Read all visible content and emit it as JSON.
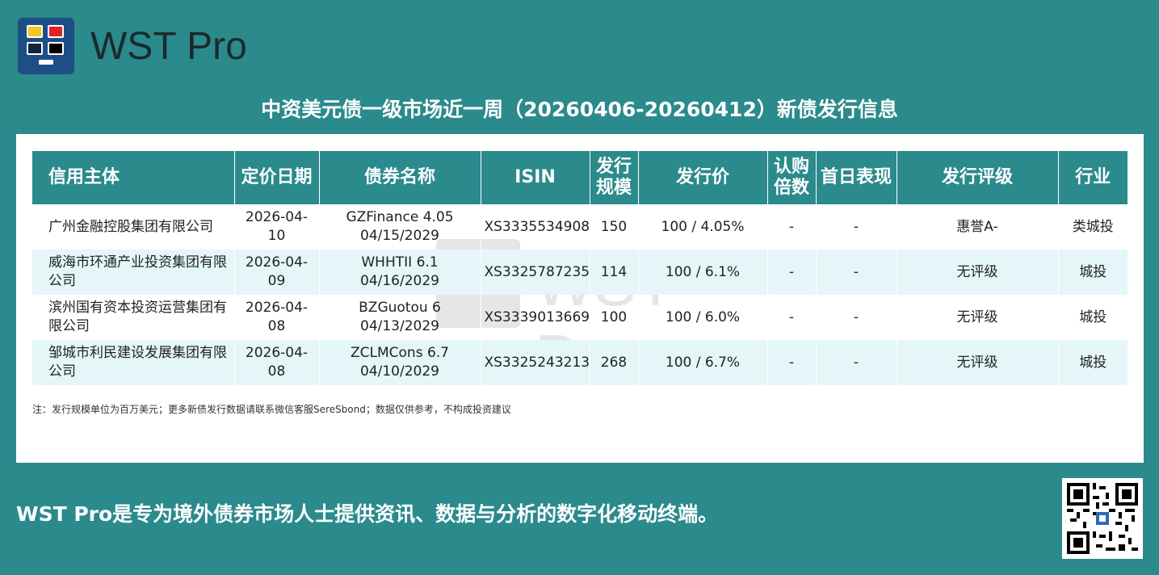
{
  "brand": {
    "name": "WST Pro"
  },
  "title": "中资美元债一级市场近一周（20260406-20260412）新债发行信息",
  "table": {
    "headers": {
      "issuer": "信用主体",
      "pricing_date": "定价日期",
      "bond_name": "债券名称",
      "isin": "ISIN",
      "size_1": "发行",
      "size_2": "规模",
      "price": "发行价",
      "cover_1": "认购",
      "cover_2": "倍数",
      "first_day": "首日表现",
      "rating": "发行评级",
      "industry": "行业"
    },
    "rows": [
      {
        "issuer": "广州金融控股集团有限公司",
        "pricing_date": "2026-04-10",
        "bond_line1": "GZFinance 4.05",
        "bond_line2": "04/15/2029",
        "isin": "XS3335534908",
        "size": "150",
        "price": "100 / 4.05%",
        "cover": "-",
        "first_day": "-",
        "rating": "惠誉A-",
        "industry": "类城投"
      },
      {
        "issuer": "威海市环通产业投资集团有限公司",
        "pricing_date": "2026-04-09",
        "bond_line1": "WHHTII 6.1",
        "bond_line2": "04/16/2029",
        "isin": "XS3325787235",
        "size": "114",
        "price": "100 / 6.1%",
        "cover": "-",
        "first_day": "-",
        "rating": "无评级",
        "industry": "城投"
      },
      {
        "issuer": "滨州国有资本投资运营集团有限公司",
        "pricing_date": "2026-04-08",
        "bond_line1": "BZGuotou 6",
        "bond_line2": "04/13/2029",
        "isin": "XS3339013669",
        "size": "100",
        "price": "100 / 6.0%",
        "cover": "-",
        "first_day": "-",
        "rating": "无评级",
        "industry": "城投"
      },
      {
        "issuer": "邹城市利民建设发展集团有限公司",
        "pricing_date": "2026-04-08",
        "bond_line1": "ZCLMCons 6.7",
        "bond_line2": "04/10/2029",
        "isin": "XS3325243213",
        "size": "268",
        "price": "100 / 6.7%",
        "cover": "-",
        "first_day": "-",
        "rating": "无评级",
        "industry": "城投"
      }
    ]
  },
  "note": "注：发行规模单位为百万美元；更多新债发行数据请联系微信客服SereSbond；数据仅供参考，不构成投资建议",
  "tagline": "WST Pro是专为境外债券市场人士提供资讯、数据与分析的数字化移动终端。",
  "colors": {
    "primary": "#2b8a8c",
    "row_alt": "#e4f6f8",
    "logo_bg": "#1d4f86"
  },
  "icons": {
    "logo": "wst-logo-icon",
    "qr": "qr-code-icon"
  }
}
